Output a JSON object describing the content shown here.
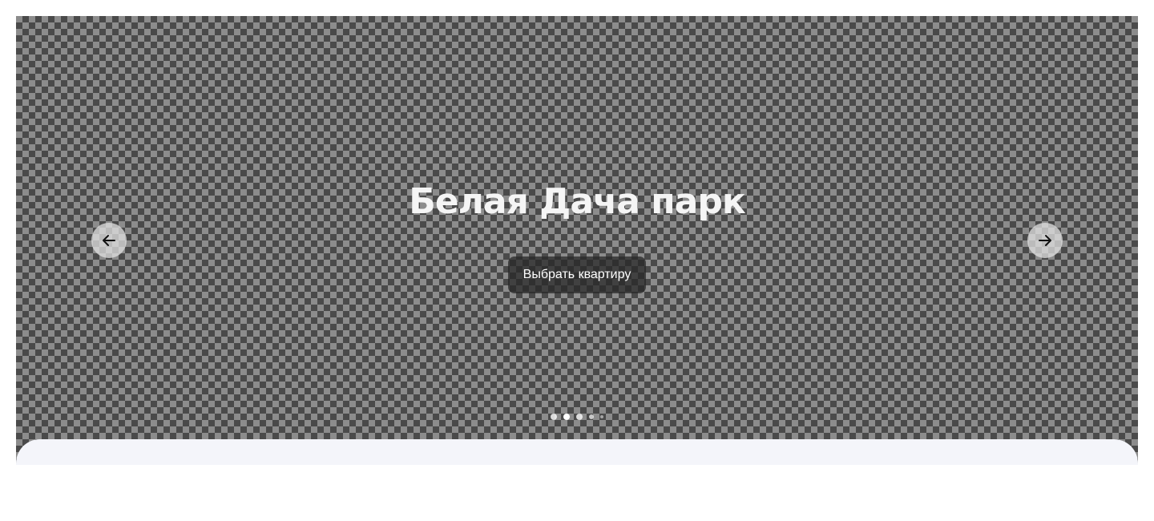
{
  "hero": {
    "title": "Белая Дача парк",
    "cta_label": "Выбрать квартиру"
  },
  "carousel": {
    "slide_count": 5,
    "active_index": 1,
    "prev_icon": "arrow-left-icon",
    "next_icon": "arrow-right-icon"
  },
  "colors": {
    "title": "#f5f5f5",
    "cta_background": "#2d2d2d",
    "panel_background": "#f4f5fa"
  }
}
